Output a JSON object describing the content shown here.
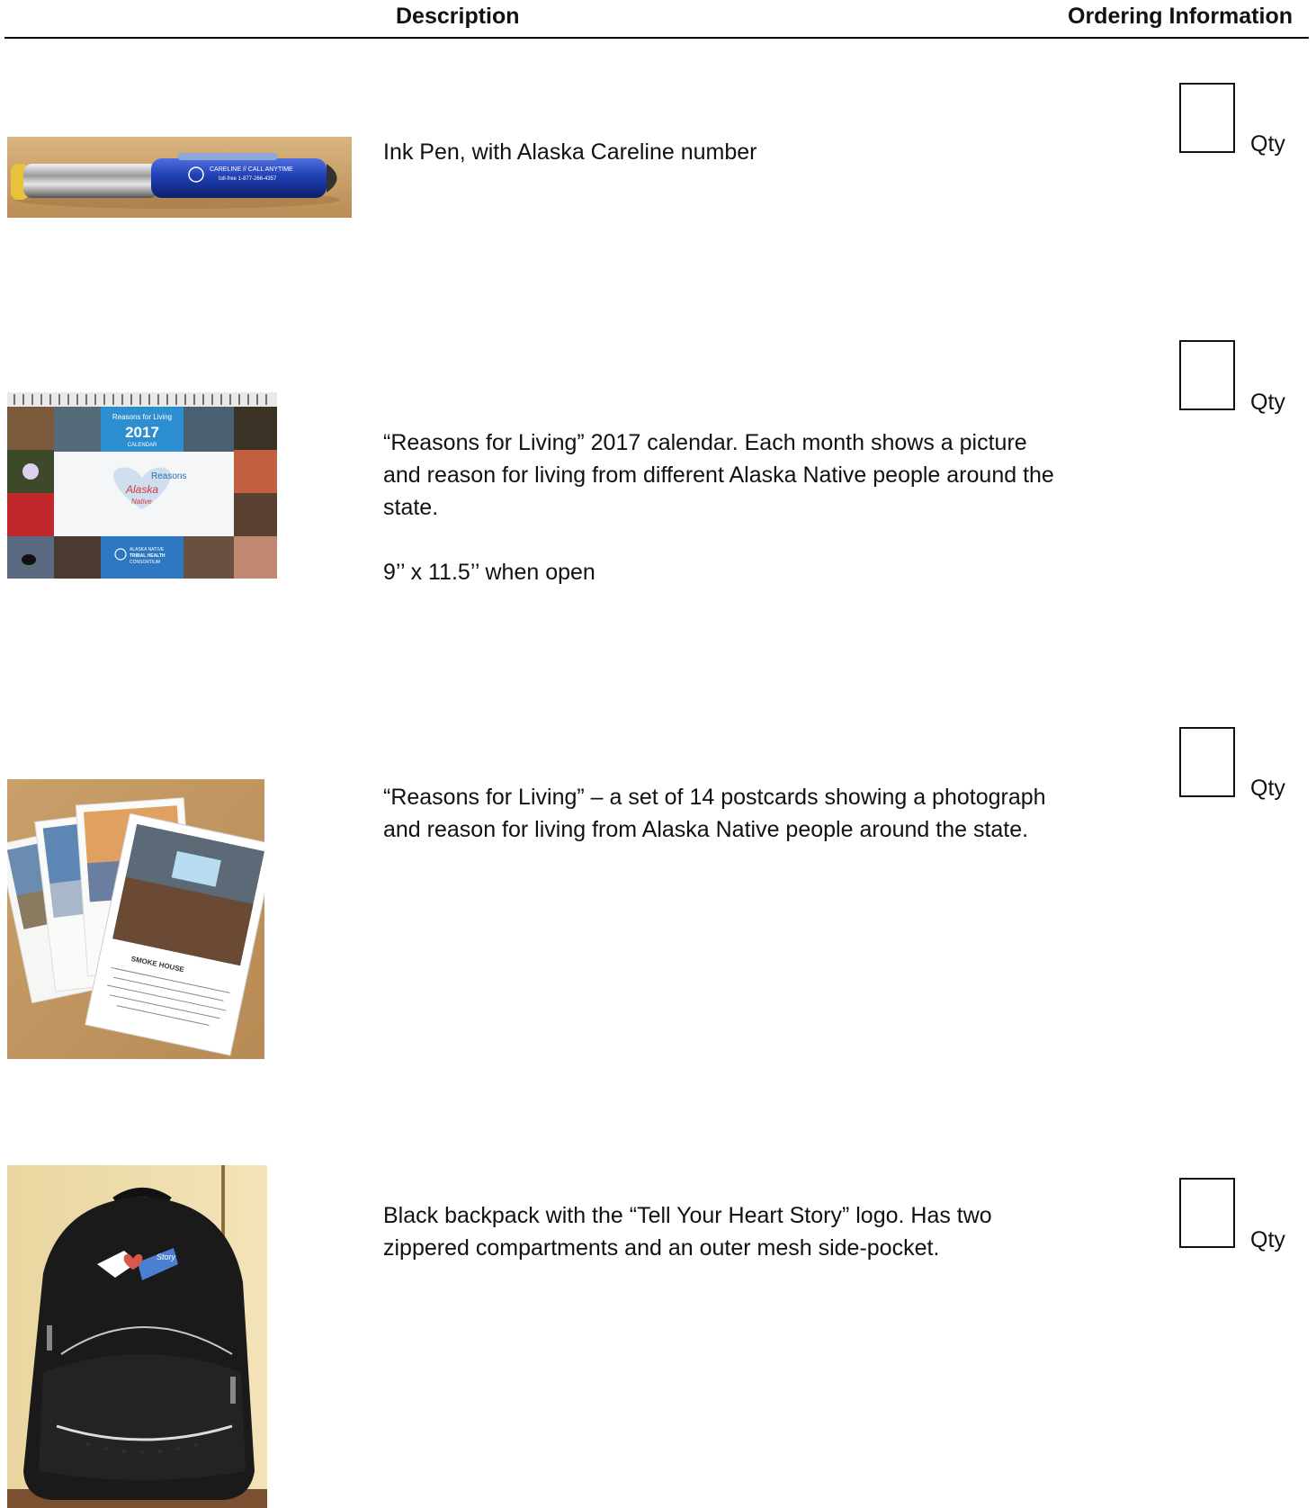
{
  "header": {
    "description_label": "Description",
    "ordering_label": "Ordering Information"
  },
  "items": [
    {
      "description": [
        "Ink Pen, with Alaska Careline number"
      ],
      "qty_label": "Qty",
      "photo": "ink-pen-photo",
      "photo_text": [
        "CARELINE // CALL ANYTIME",
        "toll-free 1-877-266-4357"
      ]
    },
    {
      "description": [
        "“Reasons for Living” 2017 calendar. Each month shows a picture and reason for living from different Alaska Native people around the state.",
        "9’’ x 11.5’’ when open"
      ],
      "qty_label": "Qty",
      "photo": "calendar-photo",
      "photo_text": [
        "Reasons for Living",
        "2017",
        "CALENDAR",
        "Alaska",
        "Native",
        "Reasons",
        "ALASKA NATIVE",
        "TRIBAL HEALTH",
        "CONSORTIUM"
      ]
    },
    {
      "description": [
        "“Reasons for Living” – a set of 14 postcards showing a photograph and reason for living from Alaska Native people around the state."
      ],
      "qty_label": "Qty",
      "photo": "postcards-photo",
      "photo_text": [
        "SMOKE HOUSE"
      ]
    },
    {
      "description": [
        "Black backpack with the “Tell Your Heart Story” logo. Has two zippered compartments and an outer mesh side-pocket."
      ],
      "qty_label": "Qty",
      "photo": "backpack-photo",
      "photo_text": [
        "Story"
      ]
    }
  ],
  "colors": {
    "pen_blue": "#1f3fb5",
    "table_wood": "#c79e68",
    "calendar_blue": "#2d8fd0",
    "backpack_black": "#1a1a1a"
  }
}
